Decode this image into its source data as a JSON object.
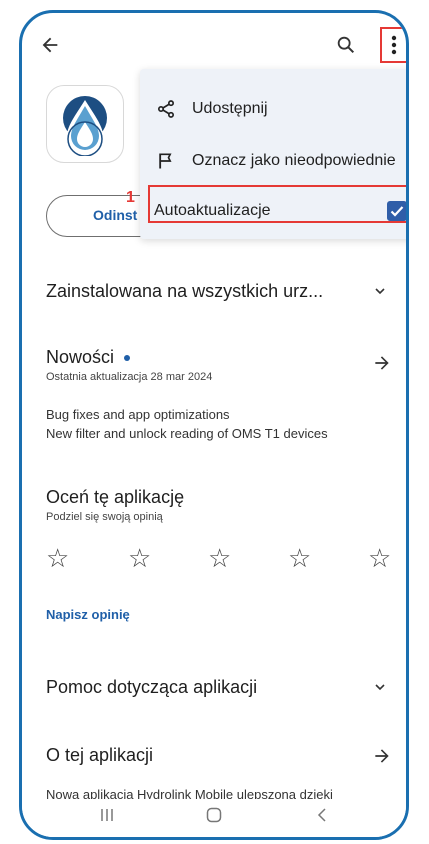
{
  "menu": {
    "items": [
      {
        "label": "Udostępnij",
        "icon": "share-icon"
      },
      {
        "label": "Oznacz jako nieodpowiednie",
        "icon": "flag-icon"
      },
      {
        "label": "Autoaktualizacje",
        "icon": "checkbox-checked-icon",
        "checked": true
      }
    ],
    "step_number": "1"
  },
  "app": {
    "uninstall_label": "Odinst"
  },
  "installed": {
    "title": "Zainstalowana na wszystkich urz..."
  },
  "news": {
    "title": "Nowości",
    "subtitle": "Ostatnia aktualizacja 28 mar 2024",
    "line1": "Bug fixes and app optimizations",
    "line2": "New filter and unlock reading of OMS T1 devices"
  },
  "rate": {
    "title": "Oceń tę aplikację",
    "subtitle": "Podziel się swoją opinią",
    "stars": 5,
    "write_review": "Napisz opinię"
  },
  "help": {
    "title": "Pomoc dotycząca aplikacji"
  },
  "about": {
    "title": "O tej aplikacji",
    "text": "Nowa aplikacja Hydrolink Mobile ulepszona dzięki"
  },
  "colors": {
    "frame": "#1a6fb0",
    "accent": "#1f5fa8",
    "highlight": "#e53935",
    "checkbox": "#2f5ea8"
  }
}
